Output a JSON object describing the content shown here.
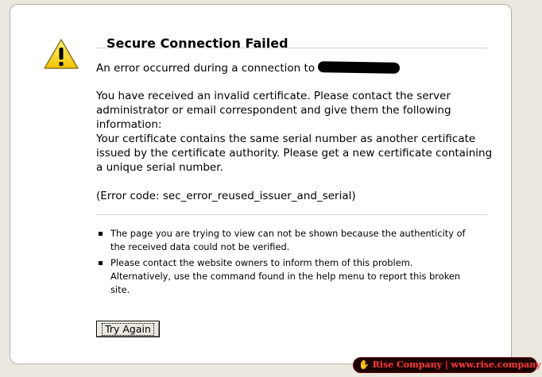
{
  "error_page": {
    "title": "Secure Connection Failed",
    "connection_line": "An error occurred during a connection to",
    "paragraph_invalid_cert": "You have received an invalid certificate.  Please contact the server administrator or email correspondent and give them the following information:",
    "paragraph_serial": "Your certificate contains the same serial number as another certificate issued by the certificate authority.  Please get a new certificate containing a unique serial number.",
    "error_code": "(Error code: sec_error_reused_issuer_and_serial)",
    "bullets": [
      "The page you are trying to view can not be shown because the authenticity of the received data could not be verified.",
      "Please contact the website owners to inform them of this problem. Alternatively, use the command found in the help menu to report this broken site."
    ],
    "try_again_label": "Try Again",
    "icon": "warning-triangle-icon"
  },
  "watermark": {
    "text": "Rise Company | www.rise.company",
    "icon": "hand-icon"
  },
  "colors": {
    "background": "#ebe8e0",
    "page": "#ffffff",
    "warning_yellow": "#f5d000",
    "watermark_red": "#ff3b3b"
  }
}
